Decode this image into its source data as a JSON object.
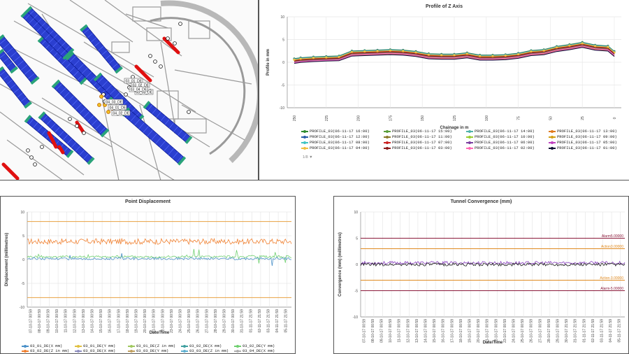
{
  "map": {
    "points": [
      {
        "label": "03_01_DE"
      },
      {
        "label": "03_02_DE"
      },
      {
        "label": "03_03_DE"
      },
      {
        "label": "03_04_DE"
      },
      {
        "label": "04_03_DE"
      },
      {
        "label": "04_01_DE"
      },
      {
        "label": "04_02_DE"
      }
    ]
  },
  "profile": {
    "title": "Profile of Z Axis",
    "ylabel": "Profile in mm",
    "xlabel": "Chainage in m",
    "yticks": [
      "10",
      "5",
      "0",
      "-5",
      "-10"
    ],
    "xticks": [
      "250",
      "225",
      "200",
      "175",
      "150",
      "125",
      "100",
      "75",
      "50",
      "25",
      "0"
    ],
    "pager": "1/8 ▼",
    "legend": [
      {
        "name": "PROFILE_03(06-11-17 16:00)",
        "color": "#2e8b2e"
      },
      {
        "name": "PROFILE_03(06-11-17 15:00)",
        "color": "#5a9e3a"
      },
      {
        "name": "PROFILE_03(06-11-17 14:00)",
        "color": "#4fb3a9"
      },
      {
        "name": "PROFILE_03(06-11-17 13:00)",
        "color": "#e07a1f"
      },
      {
        "name": "PROFILE_03(06-11-17 12:00)",
        "color": "#2b5fa8"
      },
      {
        "name": "PROFILE_03(06-11-17 11:00)",
        "color": "#8a7a2a"
      },
      {
        "name": "PROFILE_03(06-11-17 10:00)",
        "color": "#9acd32"
      },
      {
        "name": "PROFILE_03(06-11-17 09:00)",
        "color": "#d4a017"
      },
      {
        "name": "PROFILE_03(06-11-17 08:00)",
        "color": "#40c4c4"
      },
      {
        "name": "PROFILE_03(06-11-17 07:00)",
        "color": "#cc2222"
      },
      {
        "name": "PROFILE_03(06-11-17 06:00)",
        "color": "#7b3fa0"
      },
      {
        "name": "PROFILE_03(06-11-17 05:00)",
        "color": "#c040c0"
      },
      {
        "name": "PROFILE_03(06-11-17 04:00)",
        "color": "#f0c040"
      },
      {
        "name": "PROFILE_03(06-11-17 03:00)",
        "color": "#8b1a1a"
      },
      {
        "name": "PROFILE_03(06-11-17 02:00)",
        "color": "#ff69b4"
      },
      {
        "name": "PROFILE_03(06-11-17 01:00)",
        "color": "#111133"
      }
    ]
  },
  "displacement": {
    "title": "Point Displacement",
    "ylabel": "Displacement (millimetres)",
    "xlabel": "Date/Time",
    "yticks": [
      "10",
      "5",
      "0",
      "-5",
      "-10"
    ],
    "xticks": [
      "07-10-17 00:59",
      "08-10-17 00:59",
      "09-10-17 00:59",
      "10-10-17 00:59",
      "11-10-17 00:59",
      "12-10-17 00:59",
      "13-10-17 00:59",
      "14-10-17 00:59",
      "15-10-17 00:59",
      "16-10-17 00:59",
      "17-10-17 00:59",
      "18-10-17 00:59",
      "19-10-17 00:59",
      "20-10-17 00:59",
      "21-10-17 00:59",
      "22-10-17 00:59",
      "23-10-17 00:59",
      "24-10-17 00:59",
      "25-10-17 00:59",
      "26-10-17 00:59",
      "27-10-17 00:59",
      "28-10-17 00:59",
      "29-10-17 00:59",
      "30-10-17 00:59",
      "31-10-17 21:59",
      "01-11-17 21:59",
      "02-11-17 21:59",
      "03-11-17 21:59",
      "04-11-17 21:59",
      "05-11-17 21:59"
    ],
    "legend": [
      {
        "name": "03_01_DE(X mm)",
        "color": "#4a90c8"
      },
      {
        "name": "03_01_DE(Y mm)",
        "color": "#e0c040"
      },
      {
        "name": "03_01_DE(Z in mm)",
        "color": "#a0c860"
      },
      {
        "name": "03_02_DE(X mm)",
        "color": "#40a0a0"
      },
      {
        "name": "03_02_DE(Y mm)",
        "color": "#70d070"
      },
      {
        "name": "03_02_DE(Z in mm)",
        "color": "#f08030"
      },
      {
        "name": "03_03_DE(X mm)",
        "color": "#9090c0"
      },
      {
        "name": "03_03_DE(Y mm)",
        "color": "#c0a060"
      },
      {
        "name": "03_03_DE(Z in mm)",
        "color": "#60b0d0"
      },
      {
        "name": "03_04_DE(X mm)",
        "color": "#b0b0b0"
      }
    ]
  },
  "convergence": {
    "title": "Tunnel Convergence (mm)",
    "ylabel": "Convergence (mm) (millimetres)",
    "xlabel": "Date/Time",
    "yticks": [
      "10",
      "5",
      "0",
      "-5",
      "-10"
    ],
    "xticks": [
      "07-10-17 00:59",
      "08-10-17 00:59",
      "09-10-17 00:59",
      "10-10-17 00:59",
      "11-10-17 00:59",
      "12-10-17 00:59",
      "13-10-17 00:59",
      "14-10-17 00:59",
      "15-10-17 00:59",
      "16-10-17 00:59",
      "17-10-17 00:59",
      "18-10-17 00:59",
      "19-10-17 00:59",
      "20-10-17 00:59",
      "21-10-17 00:59",
      "22-10-17 00:59",
      "23-10-17 00:59",
      "24-10-17 00:59",
      "25-10-17 00:59",
      "26-10-17 00:59",
      "27-10-17 00:59",
      "28-10-17 00:59",
      "29-10-17 00:59",
      "30-10-17 21:59",
      "31-10-17 21:59",
      "01-11-17 21:59",
      "02-11-17 21:59",
      "03-11-17 21:59",
      "04-11-17 21:59",
      "05-11-17 21:59"
    ],
    "thresholds": [
      {
        "label": "Alarm5.00000",
        "value": 5,
        "color": "#8b1a3a"
      },
      {
        "label": "Action3.00000",
        "value": 3,
        "color": "#e08a20"
      },
      {
        "label": "Action-3.00000",
        "value": -3,
        "color": "#e08a20"
      },
      {
        "label": "Alarm-5.00000",
        "value": -5,
        "color": "#8b1a3a"
      }
    ]
  },
  "chart_data": [
    {
      "type": "line",
      "title": "Profile of Z Axis",
      "xlabel": "Chainage in m",
      "ylabel": "Profile in mm",
      "xlim": [
        250,
        0
      ],
      "ylim": [
        -10,
        10
      ],
      "x": [
        255,
        245,
        235,
        225,
        215,
        205,
        195,
        185,
        175,
        165,
        155,
        145,
        135,
        125,
        115,
        105,
        95,
        85,
        75,
        65,
        55,
        45,
        35,
        25,
        15,
        5,
        0
      ],
      "series": [
        {
          "name": "PROFILE_03(06-11-17 16:00)",
          "values": [
            0.8,
            1.0,
            1.2,
            1.3,
            1.4,
            2.5,
            2.6,
            2.7,
            2.8,
            2.7,
            2.4,
            1.9,
            1.8,
            1.8,
            2.1,
            1.6,
            1.6,
            1.7,
            2.0,
            2.6,
            2.8,
            3.5,
            3.9,
            4.4,
            3.8,
            3.6,
            2.4
          ]
        },
        {
          "name": "PROFILE_03(06-11-17 10:00)",
          "values": [
            0.5,
            0.7,
            0.9,
            1.0,
            1.1,
            2.2,
            2.3,
            2.4,
            2.5,
            2.4,
            2.1,
            1.6,
            1.5,
            1.5,
            1.8,
            1.3,
            1.3,
            1.4,
            1.7,
            2.3,
            2.5,
            3.2,
            3.6,
            4.1,
            3.5,
            3.3,
            2.1
          ]
        },
        {
          "name": "PROFILE_03(06-11-17 05:00)",
          "values": [
            0.2,
            0.4,
            0.6,
            0.7,
            0.8,
            1.9,
            2.0,
            2.1,
            2.2,
            2.1,
            1.8,
            1.3,
            1.2,
            1.2,
            1.5,
            1.0,
            1.0,
            1.1,
            1.4,
            2.0,
            2.2,
            2.9,
            3.3,
            3.8,
            3.2,
            3.0,
            1.8
          ]
        },
        {
          "name": "PROFILE_03(06-11-17 01:00)",
          "values": [
            0.0,
            0.2,
            0.4,
            0.5,
            0.6,
            1.6,
            1.7,
            1.8,
            1.9,
            1.8,
            1.5,
            1.0,
            0.9,
            0.9,
            1.2,
            0.7,
            0.7,
            0.8,
            1.1,
            1.7,
            1.9,
            2.6,
            3.0,
            3.5,
            2.9,
            2.7,
            1.5
          ]
        }
      ]
    },
    {
      "type": "line",
      "title": "Point Displacement",
      "xlabel": "Date/Time",
      "ylabel": "Displacement (millimetres)",
      "ylim": [
        -10,
        10
      ],
      "series": [
        {
          "name": "03_02_DE(Z in mm)",
          "level": 3.8
        },
        {
          "name": "03_02_DE(Y mm)",
          "level": 0.6
        },
        {
          "name": "03_01_DE(X mm)",
          "level": 0.2
        }
      ],
      "thresholds": [
        8,
        -8
      ]
    },
    {
      "type": "line",
      "title": "Tunnel Convergence (mm)",
      "xlabel": "Date/Time",
      "ylabel": "Convergence (mm) (millimetres)",
      "ylim": [
        -10,
        10
      ],
      "series": [
        {
          "level": 0.3
        },
        {
          "level": 0.0
        }
      ]
    }
  ]
}
